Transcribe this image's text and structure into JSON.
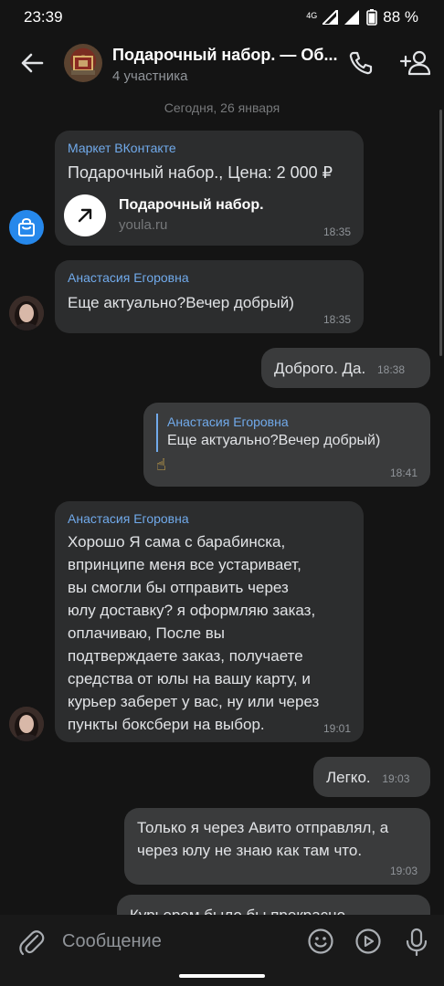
{
  "status_bar": {
    "time": "23:39",
    "network": "4G",
    "battery": "88 %"
  },
  "header": {
    "title": "Подарочный набор. — Об...",
    "subtitle": "4 участника"
  },
  "date_separator": "Сегодня, 26 января",
  "messages": [
    {
      "sender": "Маркет ВКонтакте",
      "text": "Подарочный набор., Цена: 2 000 ₽",
      "link_title": "Подарочный набор.",
      "link_domain": "youla.ru",
      "time": "18:35"
    },
    {
      "sender": "Анастасия Егоровна",
      "text": "Еще актуально?Вечер добрый)",
      "time": "18:35"
    },
    {
      "text": "Доброго. Да.",
      "time": "18:38"
    },
    {
      "reply_sender": "Анастасия Егоровна",
      "reply_text": "Еще актуально?Вечер добрый)",
      "text": "☝",
      "time": "18:41"
    },
    {
      "sender": "Анастасия Егоровна",
      "lines": [
        "Хорошо Я сама с барабинска,",
        "впринципе меня все устаривает,",
        "вы смогли бы отправить через",
        "юлу доставку? я оформляю заказ,",
        "оплачиваю, После вы",
        "подтверждаете заказ, получаете",
        "средства от юлы на вашу карту, и",
        "курьер заберет у вас, ну или через",
        "пункты боксбери на выбор."
      ],
      "time": "19:01"
    },
    {
      "text": "Легко.",
      "time": "19:03"
    },
    {
      "lines": [
        "Только я через Авито отправлял, а",
        "через юлу не знаю как там что."
      ],
      "time": "19:03"
    },
    {
      "text": "Курьером было бы прекрасно"
    }
  ],
  "composer": {
    "placeholder": "Сообщение"
  },
  "colors": {
    "accent": "#71aaeb",
    "background": "#141414",
    "bubble_in": "#2c2d2e",
    "bubble_out": "#3a3b3c",
    "market_badge": "#2688eb"
  },
  "icons": [
    "back-arrow-icon",
    "phone-icon",
    "add-user-icon",
    "paperclip-icon",
    "emoji-icon",
    "play-icon",
    "microphone-icon",
    "shopping-bag-icon",
    "arrow-up-right-icon"
  ]
}
